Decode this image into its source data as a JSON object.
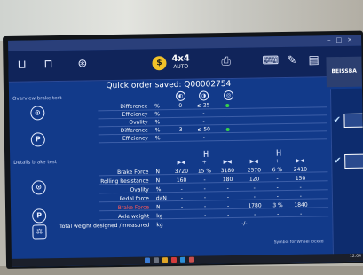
{
  "screen": {
    "title": "",
    "order_message": "Quick order saved: Q00002754",
    "toolbar": {
      "items": [
        {
          "name": "vehicle-lift-icon",
          "glyph": "⊔"
        },
        {
          "name": "axle-icon",
          "glyph": "⊓"
        },
        {
          "name": "brake-disc-icon",
          "glyph": "⊛"
        },
        {
          "name": "coin-badge-icon",
          "glyph": "$"
        },
        {
          "name": "printer-icon",
          "glyph": "⎙"
        },
        {
          "name": "keyboard-icon",
          "glyph": "⌨"
        },
        {
          "name": "edit-icon",
          "glyph": "✎"
        },
        {
          "name": "clipboard-icon",
          "glyph": "▤"
        }
      ],
      "mode_label": "4x4",
      "mode_sub": "AUTO",
      "brand": "BEISSBA"
    },
    "overview": {
      "title": "Overview brake test",
      "header_icons": [
        "left-wheel-icon",
        "right-wheel-icon",
        "status-icon"
      ],
      "rows": [
        {
          "label": "Difference",
          "unit": "%",
          "v1": "0",
          "v2": "≤ 25",
          "ok": true
        },
        {
          "label": "Efficiency",
          "unit": "%",
          "v1": "-",
          "v2": "-",
          "ok": false
        },
        {
          "label": "Ovality",
          "unit": "%",
          "v1": "-",
          "v2": "-",
          "ok": false
        },
        {
          "label": "Difference",
          "unit": "%",
          "v1": "3",
          "v2": "≤ 50",
          "ok": true
        },
        {
          "label": "Efficiency",
          "unit": "%",
          "v1": "-",
          "v2": "-",
          "ok": false
        }
      ]
    },
    "details": {
      "title": "Details brake test",
      "rows": [
        {
          "label": "Brake Force",
          "unit": "N",
          "cells": [
            "3720",
            "15 %",
            "3180",
            "2570",
            "6 %",
            "2410"
          ]
        },
        {
          "label": "Rolling Resistance",
          "unit": "N",
          "cells": [
            "160",
            "-",
            "180",
            "120",
            "-",
            "150"
          ]
        },
        {
          "label": "Ovality",
          "unit": "%",
          "cells": [
            "-",
            "-",
            "-",
            "-",
            "-",
            "-"
          ]
        },
        {
          "label": "Pedal force",
          "unit": "daN",
          "cells": [
            "-",
            "-",
            "-",
            "-",
            "-",
            "-"
          ]
        },
        {
          "label": "Brake Force",
          "unit": "N",
          "cells": [
            "-",
            "-",
            "-",
            "1780",
            "3 %",
            "1840"
          ]
        },
        {
          "label": "Axle weight",
          "unit": "kg",
          "cells": [
            "-",
            "-",
            "-",
            "-",
            "-",
            "-"
          ]
        },
        {
          "label": "Total weight designed / measured",
          "unit": "kg",
          "cells": [
            "-/-"
          ]
        }
      ],
      "legend": "Symbol for Wheel locked"
    },
    "taskbar": {
      "time": "12:04"
    },
    "colors": {
      "screen_bg": "#123a8a",
      "ok_green": "#38d24a",
      "brand_red": "#ff5a5a"
    }
  }
}
